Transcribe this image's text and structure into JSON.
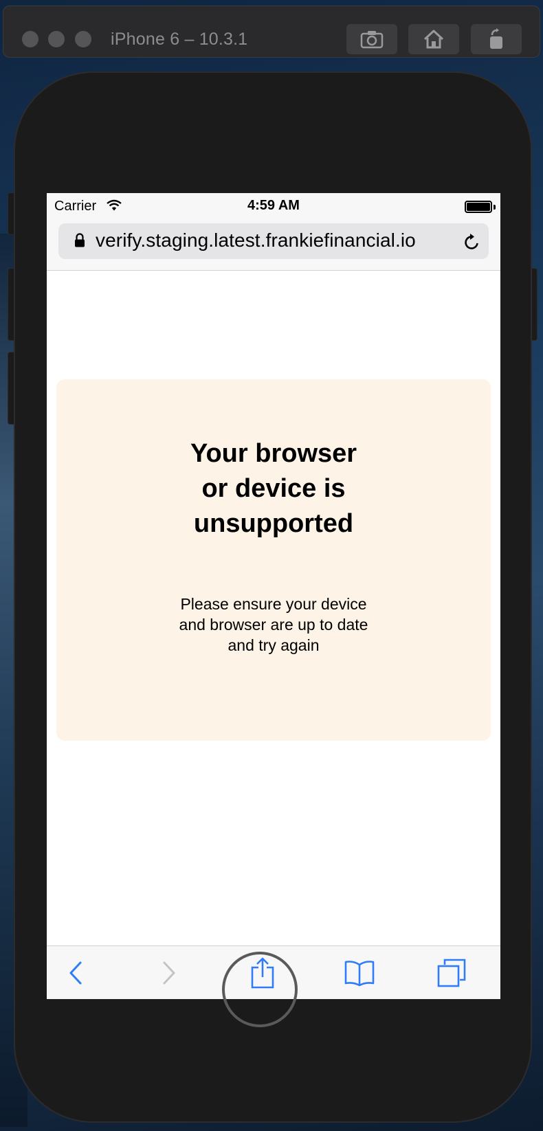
{
  "simulator": {
    "title": "iPhone 6 – 10.3.1",
    "buttons": [
      "screenshot-icon",
      "home-icon",
      "rotate-icon"
    ]
  },
  "status_bar": {
    "carrier": "Carrier",
    "time": "4:59 AM"
  },
  "browser": {
    "url": "verify.staging.latest.frankiefinancial.io"
  },
  "page": {
    "title_lines": [
      "Your browser",
      "or device is",
      "unsupported"
    ],
    "message_lines": [
      "Please ensure your device",
      "and browser are up to date",
      "and try again"
    ]
  },
  "toolbar": {
    "items": [
      "back-icon",
      "forward-icon",
      "share-icon",
      "bookmarks-icon",
      "tabs-icon"
    ]
  },
  "colors": {
    "accent": "#2f7cf6",
    "card_background": "#fdf3e6",
    "disabled": "#c4c4c6"
  }
}
